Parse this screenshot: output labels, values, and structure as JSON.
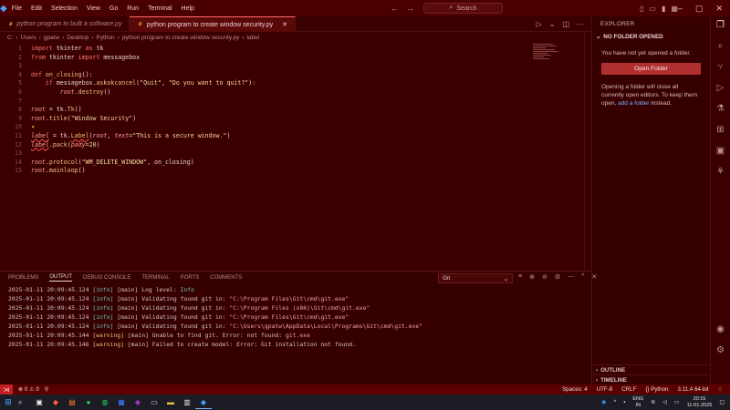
{
  "titlebar": {
    "menu": [
      "File",
      "Edit",
      "Selection",
      "View",
      "Go",
      "Run",
      "Terminal",
      "Help"
    ],
    "search_placeholder": "Search"
  },
  "tabs": [
    {
      "label": "python program to built a software.py",
      "active": false
    },
    {
      "label": "python program to create window security.py",
      "active": true
    }
  ],
  "breadcrumb": [
    "C:",
    "Users",
    "gpatw",
    "Desktop",
    "Python",
    "python program to create window security.py",
    "label"
  ],
  "code_lines": [
    {
      "n": "1",
      "html": "<span class='kw'>import</span> tkinter <span class='kw'>as</span> tk"
    },
    {
      "n": "2",
      "html": "<span class='kw'>from</span> tkinter <span class='kw'>import</span> messagebox"
    },
    {
      "n": "3",
      "html": ""
    },
    {
      "n": "4",
      "html": "<span class='kw'>def</span> <span class='fn'>on_closing</span>():"
    },
    {
      "n": "5",
      "html": "    <span class='kw'>if</span> messagebox.<span class='fn'>askokcancel</span>(<span class='str'>\"Quit\"</span>, <span class='str'>\"Do you want to quit?\"</span>):"
    },
    {
      "n": "6",
      "html": "        <span class='var'>root</span>.<span class='fn'>destroy</span>()"
    },
    {
      "n": "7",
      "html": ""
    },
    {
      "n": "8",
      "html": "<span class='var'>root</span> = tk.<span class='fn'>Tk</span>()"
    },
    {
      "n": "9",
      "html": "<span class='var'>root</span>.<span class='fn'>title</span>(<span class='str'>\"Window Security\"</span>)"
    },
    {
      "n": "10",
      "html": ""
    },
    {
      "n": "11",
      "html": "<span class='var sq'>label</span> = tk.<span class='fn sq'>Label</span>(<span class='var'>root</span>, <span class='var'>text</span>=<span class='str'>\"This is a secure window.\"</span>)"
    },
    {
      "n": "12",
      "html": "<span class='var sq'>label</span>.<span class='fn'>pack</span>(<span class='var'>pady</span>=<span class='str'>20</span>)"
    },
    {
      "n": "13",
      "html": ""
    },
    {
      "n": "14",
      "html": "<span class='var'>root</span>.<span class='fn'>protocol</span>(<span class='str'>\"WM_DELETE_WINDOW\"</span>, on_closing)"
    },
    {
      "n": "15",
      "html": "<span class='var'>root</span>.<span class='fn'>mainloop</span>()"
    }
  ],
  "explorer": {
    "title": "EXPLORER",
    "folder_header": "NO FOLDER OPENED",
    "message": "You have not yet opened a folder.",
    "open_button": "Open Folder",
    "hint_before": "Opening a folder will close all currently open editors. To keep them open, ",
    "hint_link": "add a folder",
    "hint_after": " instead.",
    "outline": "OUTLINE",
    "timeline": "TIMELINE"
  },
  "panel": {
    "tabs": [
      "PROBLEMS",
      "OUTPUT",
      "DEBUG CONSOLE",
      "TERMINAL",
      "PORTS",
      "COMMENTS"
    ],
    "active_tab": "OUTPUT",
    "output_channel": "Git",
    "log": [
      {
        "ts": "2025-01-11 20:09:45.124",
        "level": "[info]",
        "type": "info",
        "msg": " [main] Log level: ",
        "tail": "Info",
        "tail_type": "info"
      },
      {
        "ts": "2025-01-11 20:09:45.124",
        "level": "[info]",
        "type": "info",
        "msg": " [main] Validating found git in: ",
        "tail": "\"C:\\Program Files\\Git\\cmd\\git.exe\"",
        "tail_type": "q"
      },
      {
        "ts": "2025-01-11 20:09:45.124",
        "level": "[info]",
        "type": "info",
        "msg": " [main] Validating found git in: ",
        "tail": "\"C:\\Program Files (x86)\\Git\\cmd\\git.exe\"",
        "tail_type": "q"
      },
      {
        "ts": "2025-01-11 20:09:45.124",
        "level": "[info]",
        "type": "info",
        "msg": " [main] Validating found git in: ",
        "tail": "\"C:\\Program Files\\Git\\cmd\\git.exe\"",
        "tail_type": "q"
      },
      {
        "ts": "2025-01-11 20:09:45.124",
        "level": "[info]",
        "type": "info",
        "msg": " [main] Validating found git in: ",
        "tail": "\"C:\\Users\\gpatw\\AppData\\Local\\Programs\\Git\\cmd\\git.exe\"",
        "tail_type": "q"
      },
      {
        "ts": "2025-01-11 20:09:45.144",
        "level": "[warning]",
        "type": "warn",
        "msg": " [main] Unable to find git. Error: not found: ",
        "tail": "git.exe",
        "tail_type": "q"
      },
      {
        "ts": "2025-01-11 20:09:45.146",
        "level": "[warning]",
        "type": "warn",
        "msg": " [main] Failed to create model: Error: Git installation not found.",
        "tail": "",
        "tail_type": "q"
      }
    ]
  },
  "statusbar": {
    "errors": "⊗ 0  ⚠ 0",
    "spaces": "Spaces: 4",
    "encoding": "UTF-8",
    "eol": "CRLF",
    "language": "{} Python",
    "interpreter": "3.11.4 64-bit"
  },
  "taskbar": {
    "lang_top": "ENG",
    "lang_bottom": "IN",
    "time": "20:15",
    "date": "11-01-2025"
  }
}
